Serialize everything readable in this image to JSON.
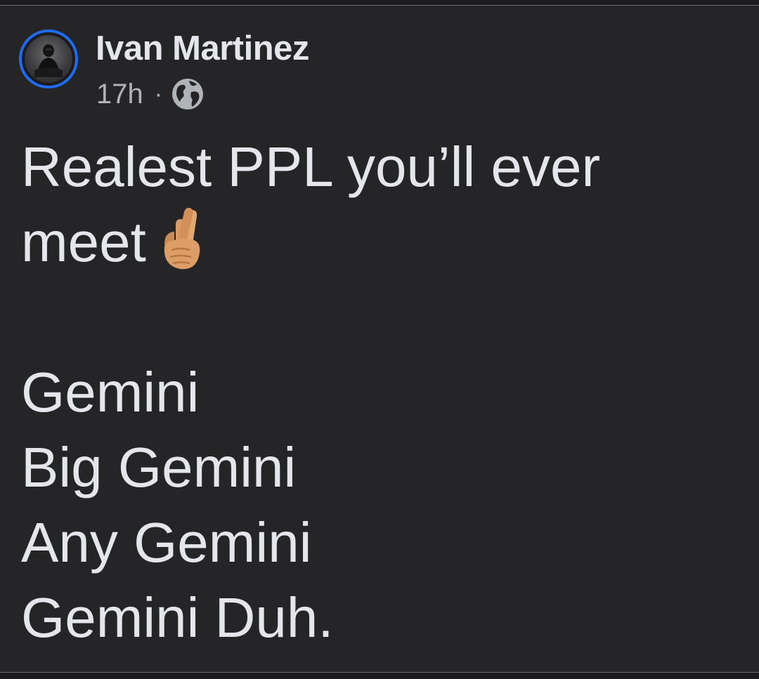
{
  "post": {
    "author": "Ivan Martinez",
    "timestamp": "17h",
    "separator": "·",
    "audience_icon": "globe-icon",
    "avatar_ring_color": "#1d6cf2",
    "background_color": "#252527",
    "text_color": "#e4e6eb",
    "body": {
      "line_1": "Realest PPL you’ll ever",
      "line_2": "meet",
      "emoji": "crossed-fingers-medium-skin-tone",
      "list": [
        "Gemini",
        "Big Gemini",
        "Any Gemini",
        "Gemini Duh."
      ]
    }
  }
}
